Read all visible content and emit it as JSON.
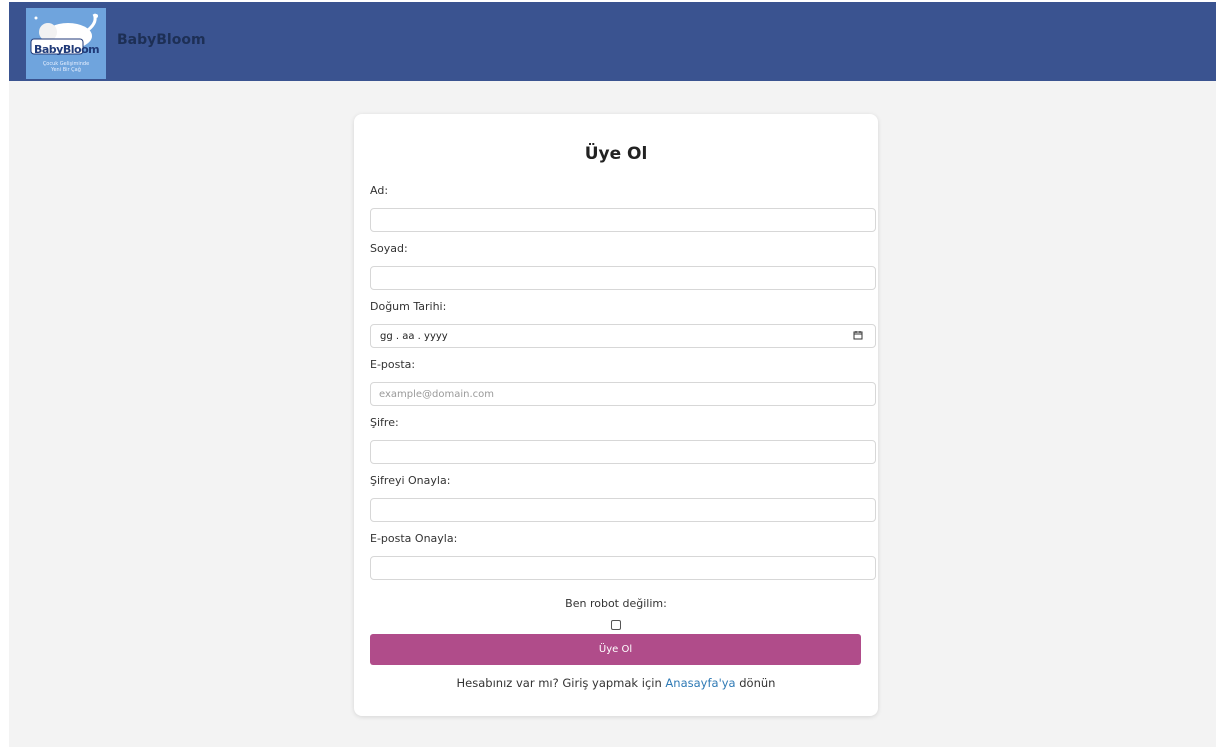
{
  "header": {
    "logo_text": "BabyBloom",
    "logo_tagline": "Çocuk Gelişiminde\nYeni Bir Çağ",
    "brand": "BabyBloom",
    "color": "#3a5390"
  },
  "form": {
    "title": "Üye Ol",
    "fields": {
      "first_name": {
        "label": "Ad:",
        "value": ""
      },
      "last_name": {
        "label": "Soyad:",
        "value": ""
      },
      "birth_date": {
        "label": "Doğum Tarihi:",
        "value": "gg . aa . yyyy",
        "icon": "calendar-icon"
      },
      "email": {
        "label": "E-posta:",
        "value": "",
        "placeholder": "example@domain.com"
      },
      "password": {
        "label": "Şifre:",
        "value": ""
      },
      "password_confirm": {
        "label": "Şifreyi Onayla:",
        "value": ""
      },
      "email_confirm": {
        "label": "E-posta Onayla:",
        "value": ""
      }
    },
    "robot_label": "Ben robot değilim:",
    "robot_checked": false,
    "submit_label": "Üye Ol",
    "submit_color": "#b04c8a",
    "footer_text": "Hesabınız var mı? Giriş yapmak için",
    "footer_link": "Anasayfa'ya",
    "footer_suffix": "dönün",
    "link_color": "#2f7ab5"
  }
}
